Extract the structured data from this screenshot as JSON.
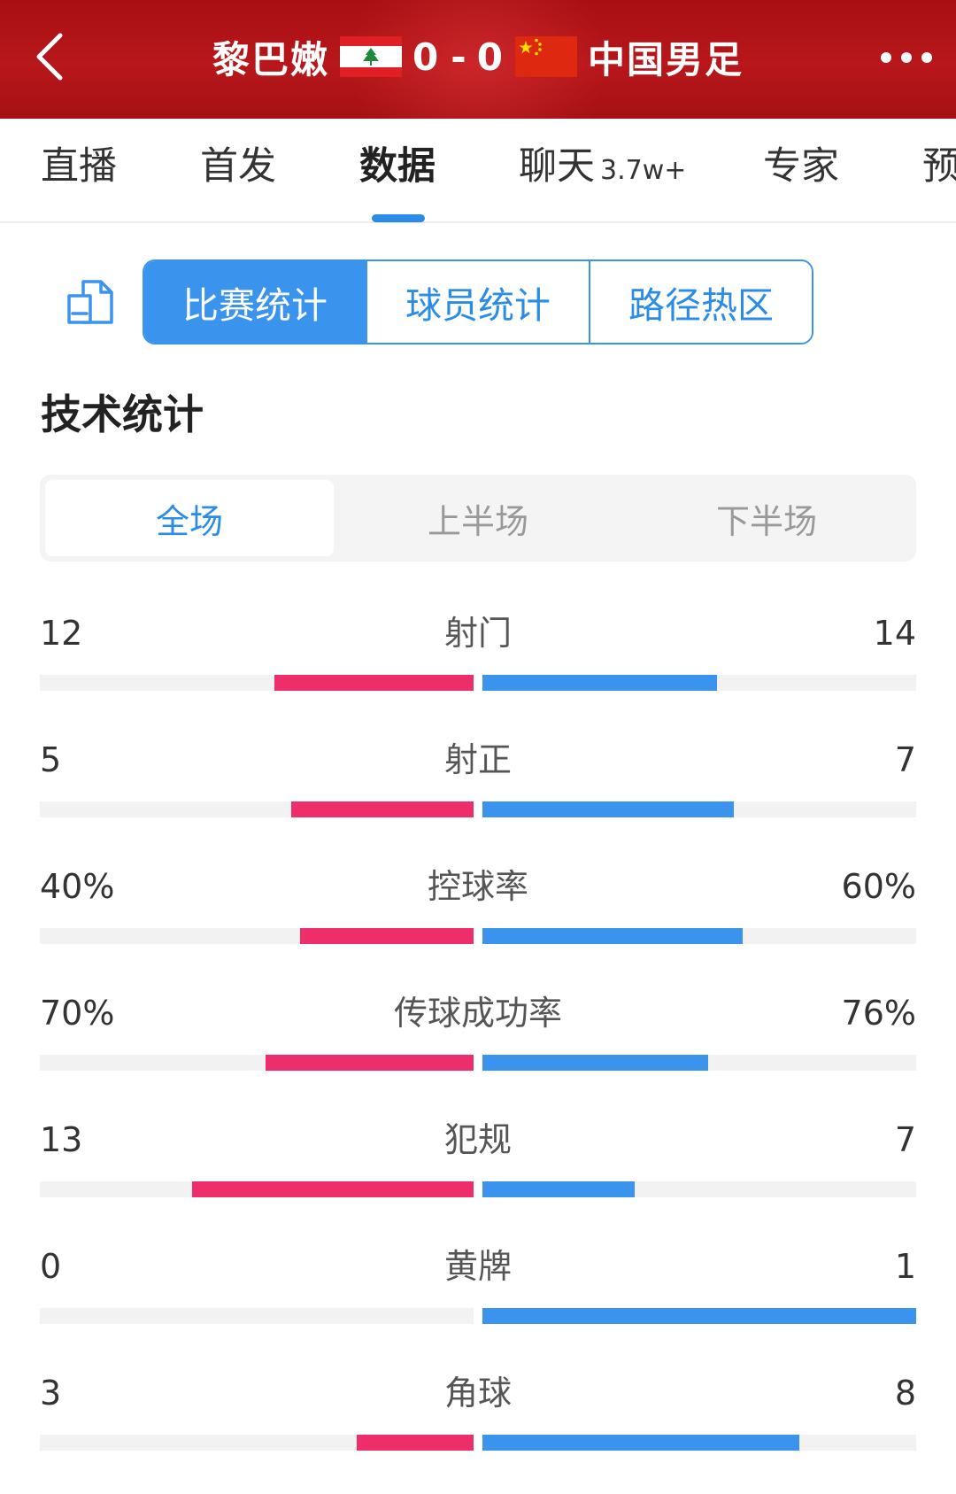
{
  "header": {
    "home_team": "黎巴嫩",
    "away_team": "中国男足",
    "home_score": "0",
    "separator": "-",
    "away_score": "0",
    "back_icon": "chevron-left-icon",
    "more_icon": "more-dots-icon",
    "home_flag_icon": "lebanon-flag-icon",
    "away_flag_icon": "china-flag-icon",
    "background_color": "#b1151a"
  },
  "main_tabs": [
    {
      "label": "直播",
      "badge": ""
    },
    {
      "label": "首发",
      "badge": ""
    },
    {
      "label": "数据",
      "badge": "",
      "active": true
    },
    {
      "label": "聊天",
      "badge": "3.7w+"
    },
    {
      "label": "专家",
      "badge": ""
    },
    {
      "label": "预",
      "badge": ""
    }
  ],
  "sub_tabs": {
    "icon": "document-switch-icon",
    "items": [
      "比赛统计",
      "球员统计",
      "路径热区"
    ],
    "active_index": 0
  },
  "section_title": "技术统计",
  "period_tabs": {
    "items": [
      "全场",
      "上半场",
      "下半场"
    ],
    "active_index": 0
  },
  "colors": {
    "home_bar": "#ee2e6a",
    "away_bar": "#3a93ec",
    "accent": "#2b8ce8"
  },
  "stats": [
    {
      "label": "射门",
      "home": "12",
      "away": "14",
      "home_frac": 0.46,
      "away_frac": 0.54
    },
    {
      "label": "射正",
      "home": "5",
      "away": "7",
      "home_frac": 0.42,
      "away_frac": 0.58
    },
    {
      "label": "控球率",
      "home": "40%",
      "away": "60%",
      "home_frac": 0.4,
      "away_frac": 0.6
    },
    {
      "label": "传球成功率",
      "home": "70%",
      "away": "76%",
      "home_frac": 0.48,
      "away_frac": 0.52
    },
    {
      "label": "犯规",
      "home": "13",
      "away": "7",
      "home_frac": 0.65,
      "away_frac": 0.35
    },
    {
      "label": "黄牌",
      "home": "0",
      "away": "1",
      "home_frac": 0.0,
      "away_frac": 1.0
    },
    {
      "label": "角球",
      "home": "3",
      "away": "8",
      "home_frac": 0.27,
      "away_frac": 0.73
    }
  ]
}
